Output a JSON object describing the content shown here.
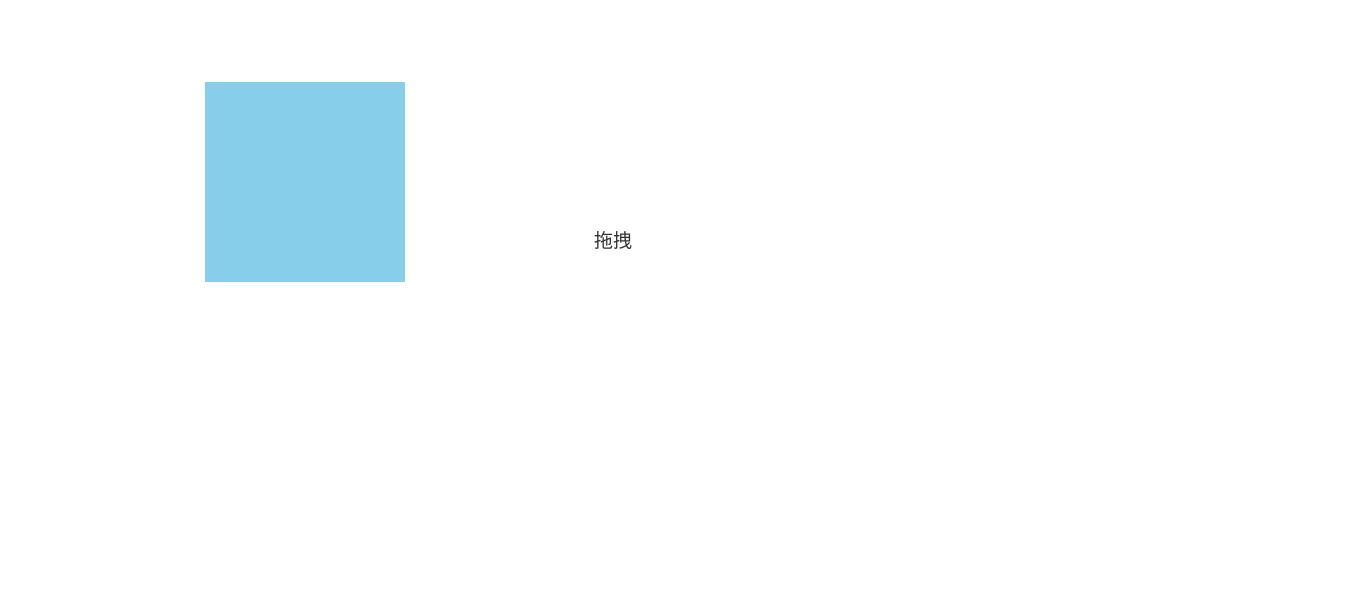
{
  "colors": {
    "box": "#87ceeb",
    "label": "#333333",
    "background": "#ffffff"
  },
  "drag_label": "拖拽"
}
